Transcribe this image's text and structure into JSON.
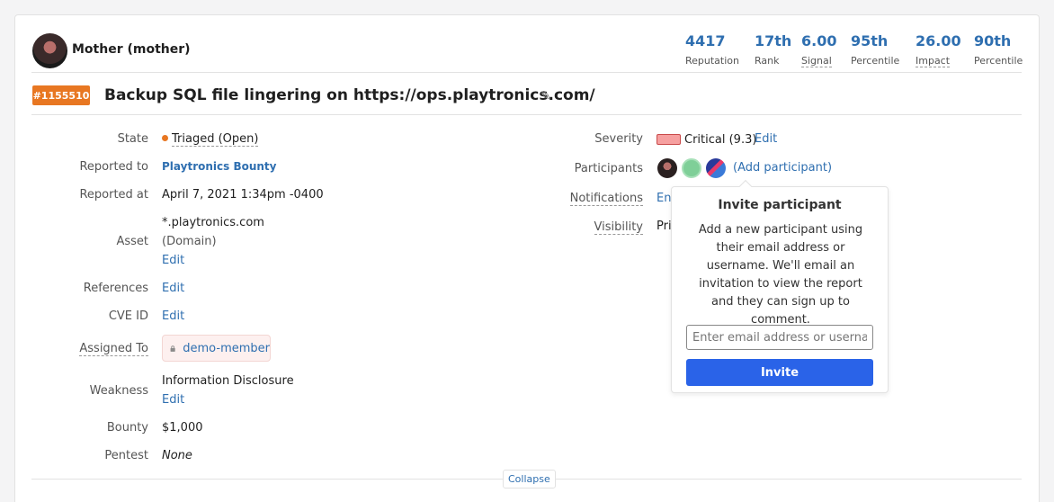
{
  "reporter": {
    "name": "Mother (mother)"
  },
  "stats": [
    {
      "value": "4417",
      "label": "Reputation"
    },
    {
      "value": "17th",
      "label": "Rank"
    },
    {
      "value": "6.00",
      "label": "Signal"
    },
    {
      "value": "95th",
      "label": "Percentile"
    },
    {
      "value": "26.00",
      "label": "Impact"
    },
    {
      "value": "90th",
      "label": "Percentile"
    }
  ],
  "report": {
    "id": "#1155510",
    "title": "Backup SQL file lingering on https://ops.playtronics.com/"
  },
  "left_fields": {
    "state_label": "State",
    "state_value": "Triaged (Open)",
    "reported_to_label": "Reported to",
    "reported_to_value": "Playtronics Bounty",
    "reported_at_label": "Reported at",
    "reported_at_value": "April 7, 2021 1:34pm -0400",
    "asset_label": "Asset",
    "asset_value": "*.playtronics.com",
    "asset_type": "(Domain)",
    "asset_edit": "Edit",
    "references_label": "References",
    "references_edit": "Edit",
    "cve_label": "CVE ID",
    "cve_edit": "Edit",
    "assigned_label": "Assigned To",
    "assigned_value": "demo-member",
    "weakness_label": "Weakness",
    "weakness_value": "Information Disclosure",
    "weakness_edit": "Edit",
    "bounty_label": "Bounty",
    "bounty_value": "$1,000",
    "pentest_label": "Pentest",
    "pentest_value": "None"
  },
  "right_fields": {
    "severity_label": "Severity",
    "severity_value": "Critical (9.3)",
    "severity_edit": "Edit",
    "participants_label": "Participants",
    "add_participant": "(Add participant)",
    "notifications_label": "Notifications",
    "notifications_value": "En",
    "visibility_label": "Visibility",
    "visibility_value": "Pri"
  },
  "popover": {
    "title": "Invite participant",
    "text": "Add a new participant using their email address or username. We'll email an invitation to view the report and they can sign up to comment.",
    "input_placeholder": "Enter email address or username",
    "button": "Invite"
  },
  "collapse_label": "Collapse",
  "colors": {
    "accent": "#2f6fb0",
    "badge": "#e87722",
    "button": "#2a63e8",
    "severity": "#f6a0a0"
  }
}
